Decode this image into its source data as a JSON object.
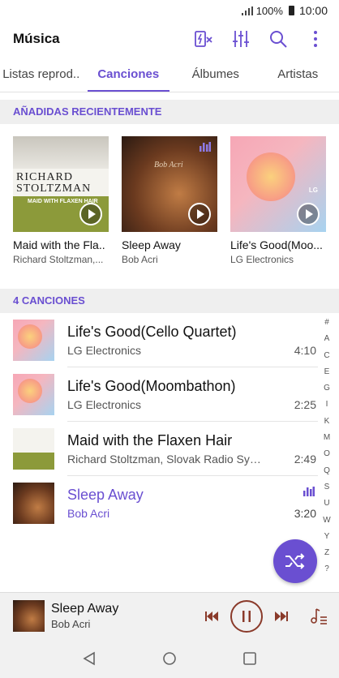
{
  "status": {
    "battery": "100%",
    "time": "10:00"
  },
  "app": {
    "title": "Música"
  },
  "toolbar": {
    "icons": [
      "media-settings-icon",
      "equalizer-icon",
      "search-icon",
      "more-options-icon"
    ]
  },
  "tabs": [
    {
      "label": "Listas reprod.."
    },
    {
      "label": "Canciones",
      "active": true
    },
    {
      "label": "Álbumes"
    },
    {
      "label": "Artistas"
    }
  ],
  "recent": {
    "header": "AÑADIDAS RECIENTEMENTE",
    "cover_text": {
      "name_line1": "RICHARD",
      "name_line2": "STOLTZMAN",
      "subtitle": "MAID WITH FLAXEN HAIR",
      "bob_signature": "Bob Acri",
      "lg_mark": "LG"
    },
    "albums": [
      {
        "title": "Maid with the Fla..",
        "artist": "Richard Stoltzman,..."
      },
      {
        "title": "Sleep Away",
        "artist": "Bob Acri"
      },
      {
        "title": "Life's Good(Moo...",
        "artist": "LG Electronics"
      }
    ]
  },
  "songs": {
    "header": "4 CANCIONES",
    "items": [
      {
        "title": "Life's Good(Cello Quartet)",
        "artist": "LG Electronics",
        "duration": "4:10"
      },
      {
        "title": "Life's Good(Moombathon)",
        "artist": "LG Electronics",
        "duration": "2:25"
      },
      {
        "title": "Maid with the Flaxen Hair",
        "artist": "Richard Stoltzman, Slovak Radio Symph...",
        "duration": "2:49"
      },
      {
        "title": "Sleep Away",
        "artist": "Bob Acri",
        "duration": "3:20",
        "playing": true
      }
    ]
  },
  "alphabet": [
    "#",
    "A",
    "C",
    "E",
    "G",
    "I",
    "K",
    "M",
    "O",
    "Q",
    "S",
    "U",
    "W",
    "Y",
    "Z",
    "?"
  ],
  "now_playing": {
    "title": "Sleep Away",
    "artist": "Bob Acri"
  },
  "colors": {
    "accent": "#6a4fd1",
    "player_controls": "#8a3a2a",
    "section_bg": "#efefef"
  }
}
